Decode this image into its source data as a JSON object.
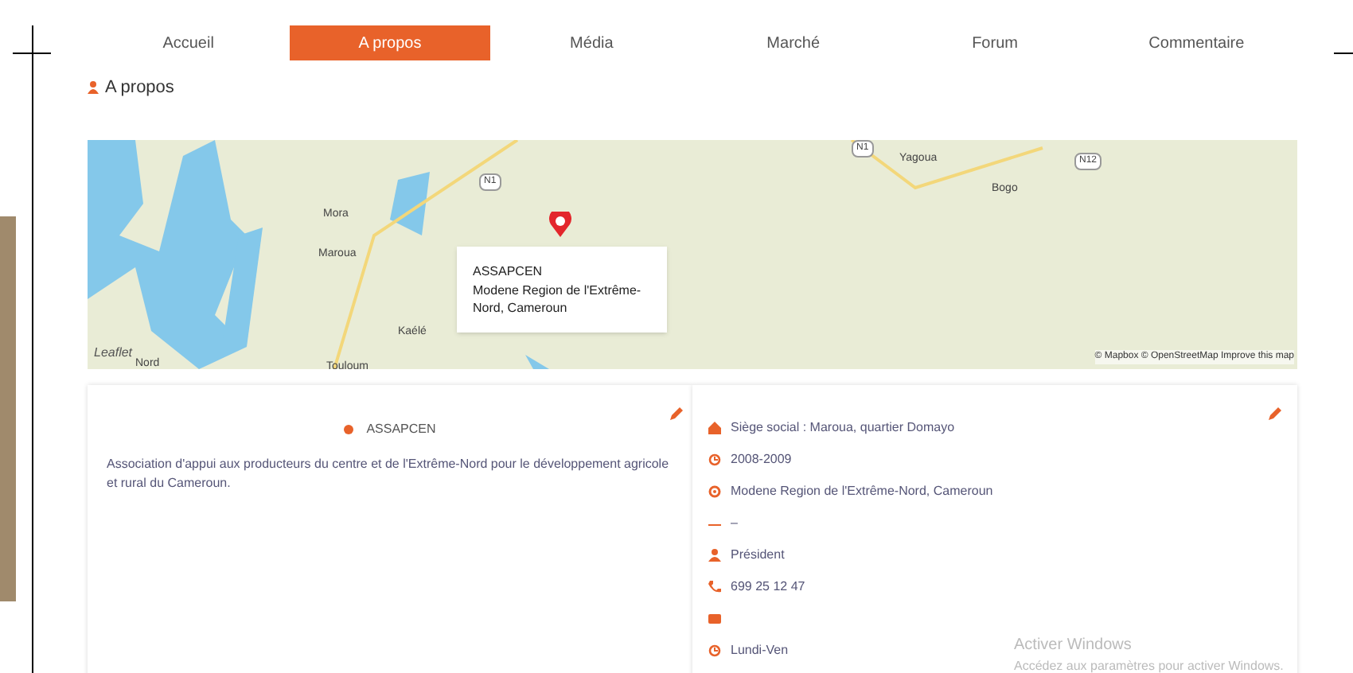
{
  "tabs": [
    {
      "label": "Accueil",
      "selected": false
    },
    {
      "label": "A propos",
      "selected": true
    },
    {
      "label": "Média",
      "selected": false
    },
    {
      "label": "Marché",
      "selected": false
    },
    {
      "label": "Forum",
      "selected": false
    },
    {
      "label": "Commentaire",
      "selected": false
    }
  ],
  "section_title": "A propos",
  "map": {
    "places": [
      "Mora",
      "Maroua",
      "Kaélé",
      "Touloum",
      "Yagoua",
      "Bogo",
      "Nord"
    ],
    "roads": [
      "N1",
      "N1",
      "N12"
    ],
    "popup": {
      "title": "ASSAPCEN",
      "address": "Modene Region de l'Extrême-Nord, Cameroun"
    },
    "brand": "Leaflet",
    "attribution": "© Mapbox © OpenStreetMap Improve this map"
  },
  "about": {
    "title": "ASSAPCEN",
    "description": "Association d'appui aux producteurs du centre et de l'Extrême-Nord pour le développement agricole et rural du Cameroun."
  },
  "contacts": [
    {
      "kind": "home",
      "text": "Siège social : Maroua, quartier Domayo"
    },
    {
      "kind": "clock",
      "text": "2008-2009"
    },
    {
      "kind": "pin",
      "text": "Modene Region de l'Extrême-Nord, Cameroun"
    },
    {
      "kind": "dash",
      "text": "–"
    },
    {
      "kind": "user",
      "text": "Président"
    },
    {
      "kind": "phone",
      "text": "699 25 12 47"
    },
    {
      "kind": "mail"
    },
    {
      "kind": "clock",
      "text": "Lundi-Ven"
    }
  ],
  "os_notice": {
    "title": "Activer Windows",
    "subtitle": "Accédez aux paramètres pour activer Windows."
  }
}
